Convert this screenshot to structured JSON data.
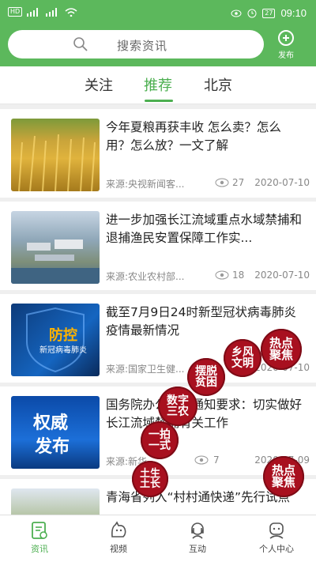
{
  "status_bar": {
    "time": "09:10",
    "battery": "27",
    "sim_label": "HD"
  },
  "search": {
    "placeholder": "搜索资讯",
    "publish_label": "发布"
  },
  "tabs": [
    {
      "label": "关注",
      "active": false
    },
    {
      "label": "推荐",
      "active": true
    },
    {
      "label": "北京",
      "active": false
    }
  ],
  "articles": [
    {
      "title": "今年夏粮再获丰收 怎么卖？怎么用？怎么放？一文了解",
      "source": "来源:央视新闻客...",
      "views": "27",
      "date": "2020-07-10"
    },
    {
      "title": "进一步加强长江流域重点水域禁捕和退捕渔民安置保障工作实...",
      "source": "来源:农业农村部...",
      "views": "18",
      "date": "2020-07-10"
    },
    {
      "title": "截至7月9日24时新型冠状病毒肺炎疫情最新情况",
      "source": "来源:国家卫生健...",
      "views": "",
      "date": "2020-07-10",
      "thumb_text_1": "防控",
      "thumb_text_2": "新冠病毒肺炎"
    },
    {
      "title": "国务院办公厅发通知要求：切实做好长江流域禁捕有关工作",
      "source": "来源:新华...",
      "views": "7",
      "date": "2020-07-09",
      "thumb_text_1": "权威",
      "thumb_text_2": "发布"
    },
    {
      "title": "青海省列入“村村通快递”先行试点",
      "source": "",
      "views": "",
      "date": ""
    }
  ],
  "stamps": [
    {
      "text": "热点聚焦"
    },
    {
      "text": "乡风文明"
    },
    {
      "text": "摆脱贫困"
    },
    {
      "text": "数字三农"
    },
    {
      "text": "一拍一式"
    },
    {
      "text": "土生土长"
    },
    {
      "text": "热点聚焦"
    }
  ],
  "bottom_nav": [
    {
      "label": "资讯",
      "icon": "news-icon",
      "active": true
    },
    {
      "label": "视频",
      "icon": "video-icon",
      "active": false
    },
    {
      "label": "互动",
      "icon": "interact-icon",
      "active": false
    },
    {
      "label": "个人中心",
      "icon": "profile-icon",
      "active": false
    }
  ],
  "colors": {
    "brand_green": "#5cb85c",
    "active_green": "#4caf50",
    "stamp_red": "#a8101f"
  }
}
